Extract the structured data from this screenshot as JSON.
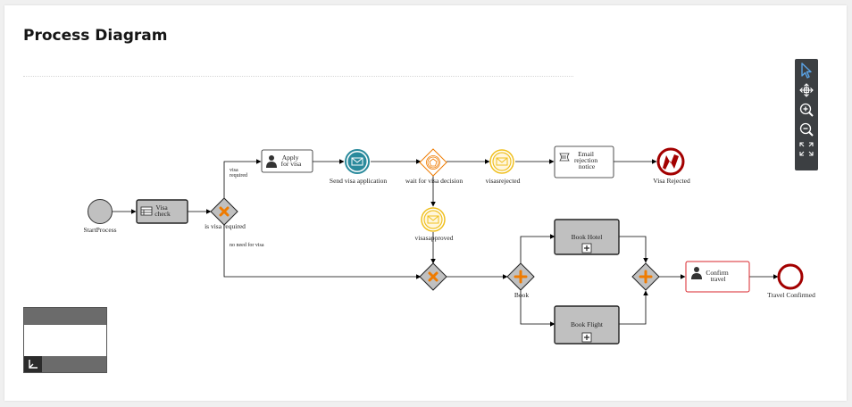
{
  "header": {
    "title": "Process Diagram"
  },
  "diagram": {
    "nodes": {
      "start": "StartProcess",
      "visa_check": [
        "Visa",
        "check"
      ],
      "gw_visa": "is visa required",
      "apply_visa": [
        "Apply",
        "for visa"
      ],
      "send_visa": "Send visa application",
      "wait_decision": "wait for visa decision",
      "visas_rejected": "visasrejected",
      "email_rejection": [
        "Email",
        "rejection",
        "notice"
      ],
      "visa_rejected_end": "Visa Rejected",
      "visas_approved": "visasapproved",
      "gw_book": "Book",
      "book_hotel": "Book Hotel",
      "book_flight": "Book Flight",
      "confirm_travel": [
        "Confirm",
        "travel"
      ],
      "travel_confirmed": "Travel Confirmed"
    },
    "edges": {
      "visa_required": [
        "visa",
        "required"
      ],
      "no_visa": "no need for visa"
    }
  },
  "colors": {
    "task_fill": "#c0c0c0",
    "message_event": "#2a8a9c",
    "signal_event": "#f0c020",
    "error_end": "#a30000",
    "gateway_marker": "#ef7b00",
    "highlight": "#d9262b",
    "toolbar_icon": "#5aa3e6"
  },
  "toolbar": {
    "icons": [
      "select-icon",
      "pan-icon",
      "zoom-in-icon",
      "zoom-out-icon",
      "fit-screen-icon"
    ]
  }
}
